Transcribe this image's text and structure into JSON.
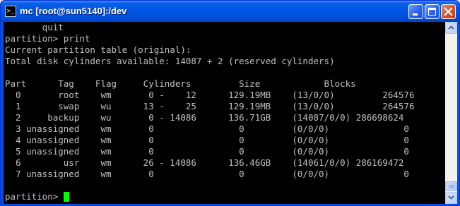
{
  "window": {
    "title": "mc [root@sun5140]:/dev",
    "icon": "terminal-icon"
  },
  "terminal": {
    "lines": [
      "       quit",
      "partition> print",
      "Current partition table (original):",
      "Total disk cylinders available: 14087 + 2 (reserved cylinders)",
      "",
      "Part      Tag    Flag     Cylinders         Size            Blocks",
      "  0       root    wm       0 -    12      129.19MB    (13/0/0)         264576",
      "  1       swap    wu      13 -    25      129.19MB    (13/0/0)         264576",
      "  2     backup    wu       0 - 14086      136.71GB    (14087/0/0) 286698624",
      "  3 unassigned    wm       0                0         (0/0/0)              0",
      "  4 unassigned    wm       0                0         (0/0/0)              0",
      "  5 unassigned    wm       0                0         (0/0/0)              0",
      "  6        usr    wm      26 - 14086      136.46GB    (14061/0/0) 286169472",
      "  7 unassigned    wm       0                0         (0/0/0)              0",
      "",
      "partition> "
    ],
    "cursor_color": "#00FF00",
    "text_color": "#C0C0C0",
    "background": "#000000"
  },
  "colors": {
    "titlebar_blue": "#0055E5",
    "close_red": "#D8522B"
  }
}
